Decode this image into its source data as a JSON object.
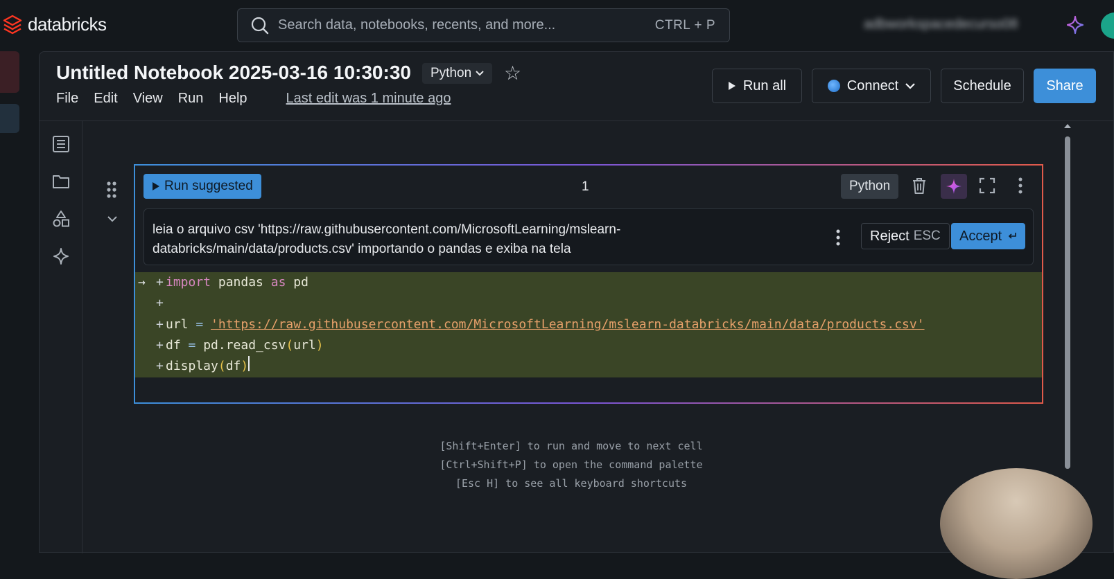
{
  "brand": {
    "name": "databricks"
  },
  "search": {
    "placeholder": "Search data, notebooks, recents, and more...",
    "shortcut": "CTRL + P"
  },
  "workspace": {
    "name": "adbworkspacedecurso08"
  },
  "notebook": {
    "title": "Untitled Notebook 2025-03-16 10:30:30",
    "language": "Python",
    "menu": [
      "File",
      "Edit",
      "View",
      "Run",
      "Help"
    ],
    "last_edit": "Last edit was 1 minute ago"
  },
  "actions": {
    "run_all": "Run all",
    "connect": "Connect",
    "schedule": "Schedule",
    "share": "Share"
  },
  "cell": {
    "run_suggested": "Run suggested",
    "number": "1",
    "language": "Python",
    "prompt": "leia o arquivo csv 'https://raw.githubusercontent.com/MicrosoftLearning/mslearn-databricks/main/data/products.csv' importando o pandas e exiba na tela",
    "reject_label": "Reject",
    "reject_kbd": "ESC",
    "accept_label": "Accept",
    "code": {
      "l1_import": "import",
      "l1_mod": " pandas ",
      "l1_as": "as",
      "l1_alias": " pd",
      "l3_var": "url",
      "l3_eq": " = ",
      "l3_str": "'https://raw.githubusercontent.com/MicrosoftLearning/mslearn-databricks/main/data/products.csv'",
      "l4_var": "df",
      "l4_eq": " = ",
      "l4_call": "pd.read_csv",
      "l4_open": "(",
      "l4_arg": "url",
      "l4_close": ")",
      "l5_fn": "display",
      "l5_open": "(",
      "l5_arg": "df",
      "l5_close": ")"
    }
  },
  "hints": [
    "[Shift+Enter] to run and move to next cell",
    "[Ctrl+Shift+P] to open the command palette",
    "[Esc H] to see all keyboard shortcuts"
  ],
  "colors": {
    "accent": "#3d8fd9",
    "suggestion_bg": "#3a4526",
    "brand_red": "#ff3621"
  }
}
